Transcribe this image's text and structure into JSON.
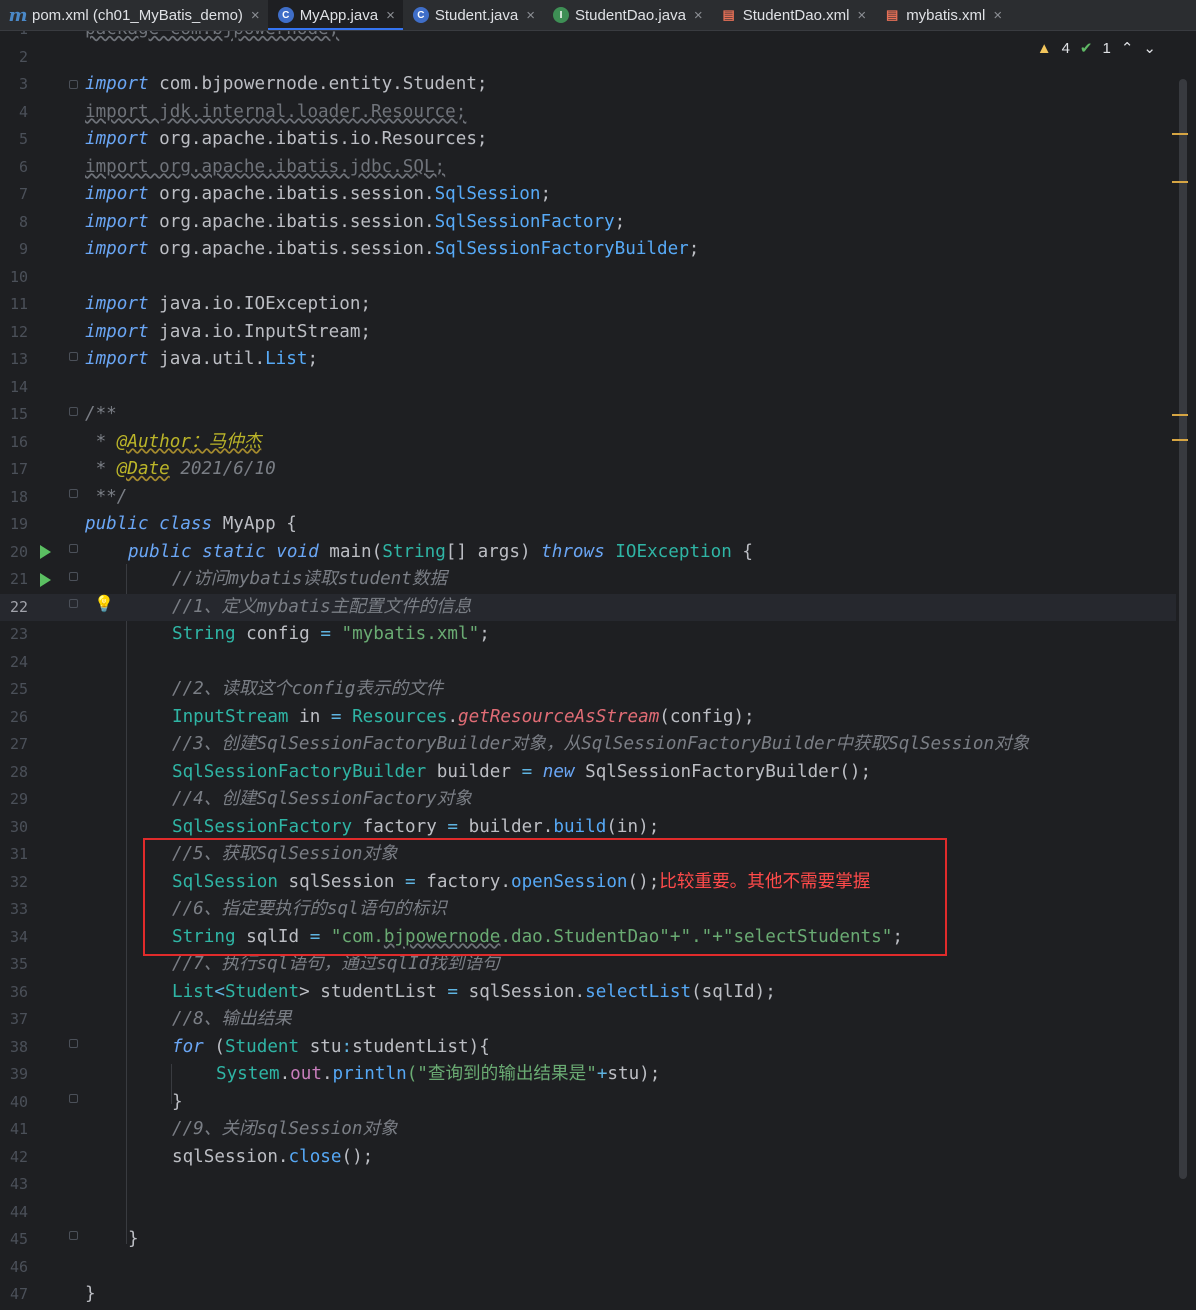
{
  "tabs": [
    {
      "label": "pom.xml (ch01_MyBatis_demo)",
      "icon": "maven-icon",
      "active": false
    },
    {
      "label": "MyApp.java",
      "icon": "java-class-icon",
      "active": true
    },
    {
      "label": "Student.java",
      "icon": "java-class-icon",
      "active": false
    },
    {
      "label": "StudentDao.java",
      "icon": "java-interface-icon",
      "active": false
    },
    {
      "label": "StudentDao.xml",
      "icon": "xml-file-icon",
      "active": false
    },
    {
      "label": "mybatis.xml",
      "icon": "xml-file-icon",
      "active": false
    }
  ],
  "inspections": {
    "warnings": "4",
    "checks": "1"
  },
  "annotation_note": "比较重要。其他不需要掌握",
  "current_line": "22",
  "lines": [
    "1",
    "2",
    "3",
    "4",
    "5",
    "6",
    "7",
    "8",
    "9",
    "10",
    "11",
    "12",
    "13",
    "14",
    "15",
    "16",
    "17",
    "18",
    "19",
    "20",
    "21",
    "22",
    "23",
    "24",
    "25",
    "26",
    "27",
    "28",
    "29",
    "30",
    "31",
    "32",
    "33",
    "34",
    "35",
    "36",
    "37",
    "38",
    "39",
    "40",
    "41",
    "42",
    "43",
    "44",
    "45",
    "46",
    "47"
  ],
  "code": {
    "l1": "package com.bjpowernode;",
    "l3a": "import",
    "l3b": " com.bjpowernode.entity.Student;",
    "l4": "import jdk.internal.loader.Resource;",
    "l5a": "import",
    "l5b": " org.apache.ibatis.io.Resources;",
    "l6": "import org.apache.ibatis.jdbc.SQL;",
    "l7a": "import",
    "l7b": " org.apache.ibatis.session.",
    "l7c": "SqlSession",
    "l7d": ";",
    "l8a": "import",
    "l8b": " org.apache.ibatis.session.",
    "l8c": "SqlSessionFactory",
    "l8d": ";",
    "l9a": "import",
    "l9b": " org.apache.ibatis.session.",
    "l9c": "SqlSessionFactoryBuilder",
    "l9d": ";",
    "l11a": "import",
    "l11b": " java.io.IOException;",
    "l12a": "import",
    "l12b": " java.io.InputStream;",
    "l13a": "import",
    "l13b": " java.util.",
    "l13c": "List",
    "l13d": ";",
    "l15": "/**",
    "l16a": " * ",
    "l16b": "@Author",
    "l16c": "：马仲杰",
    "l17a": " * ",
    "l17b": "@Date",
    "l17c": " 2021/6/10",
    "l18": " **/",
    "l19a": "public class",
    "l19b": " MyApp {",
    "l20a": "public static void",
    "l20b": " main(",
    "l20c": "String",
    "l20d": "[] args) ",
    "l20e": "throws",
    "l20f": " IOException",
    "l20g": " {",
    "l21": "//访问mybatis读取student数据",
    "l22": "//1、定义mybatis主配置文件的信息",
    "l23a": "String",
    "l23b": " config ",
    "l23c": "=",
    "l23d": " \"mybatis.xml\"",
    "l23e": ";",
    "l25": "//2、读取这个config表示的文件",
    "l26a": "InputStream",
    "l26b": " in ",
    "l26c": "=",
    "l26d": " Resources",
    "l26e": ".",
    "l26f": "getResourceAsStream",
    "l26g": "(config);",
    "l27": "//3、创建SqlSessionFactoryBuilder对象，从SqlSessionFactoryBuilder中获取SqlSession对象",
    "l28a": "SqlSessionFactoryBuilder",
    "l28b": " builder ",
    "l28c": "=",
    "l28d": " new",
    "l28e": " SqlSessionFactoryBuilder();",
    "l29": "//4、创建SqlSessionFactory对象",
    "l30a": "SqlSessionFactory",
    "l30b": " factory ",
    "l30c": "=",
    "l30d": " builder.",
    "l30e": "build",
    "l30f": "(in);",
    "l31": "//5、获取SqlSession对象",
    "l32a": "SqlSession",
    "l32b": " sqlSession ",
    "l32c": "=",
    "l32d": " factory.",
    "l32e": "openSession",
    "l32f": "();",
    "l33": "//6、指定要执行的sql语句的标识",
    "l34a": "String",
    "l34b": " sqlId ",
    "l34c": "=",
    "l34d": " \"com.",
    "l34e": "bjpowernode",
    "l34f": ".dao.StudentDao\"+\".\"+\"selectStudents\"",
    "l34g": ";",
    "l35": "//7、执行sql语句，通过sqlId找到语句",
    "l36a": "List",
    "l36b": "<",
    "l36c": "Student",
    "l36d": "> studentList ",
    "l36e": "=",
    "l36f": " sqlSession.",
    "l36g": "selectList",
    "l36h": "(sqlId);",
    "l37": "//8、输出结果",
    "l38a": "for",
    "l38b": " (",
    "l38c": "Student",
    "l38d": " stu",
    "l38e": ":",
    "l38f": "studentList){",
    "l39a": "System",
    "l39b": ".",
    "l39c": "out",
    "l39d": ".",
    "l39e": "println",
    "l39f": "(\"查询到的输出结果是\"",
    "l39g": "+",
    "l39h": "stu);",
    "l40": "}",
    "l41": "//9、关闭sqlSession对象",
    "l42a": "sqlSession.",
    "l42b": "close",
    "l42c": "();",
    "l45": "}",
    "l47": "}"
  },
  "colors": {
    "accent": "#3574f0",
    "highlight_box": "#e02b2b",
    "run_icon": "#5bbf62",
    "warning": "#f2c55c"
  }
}
